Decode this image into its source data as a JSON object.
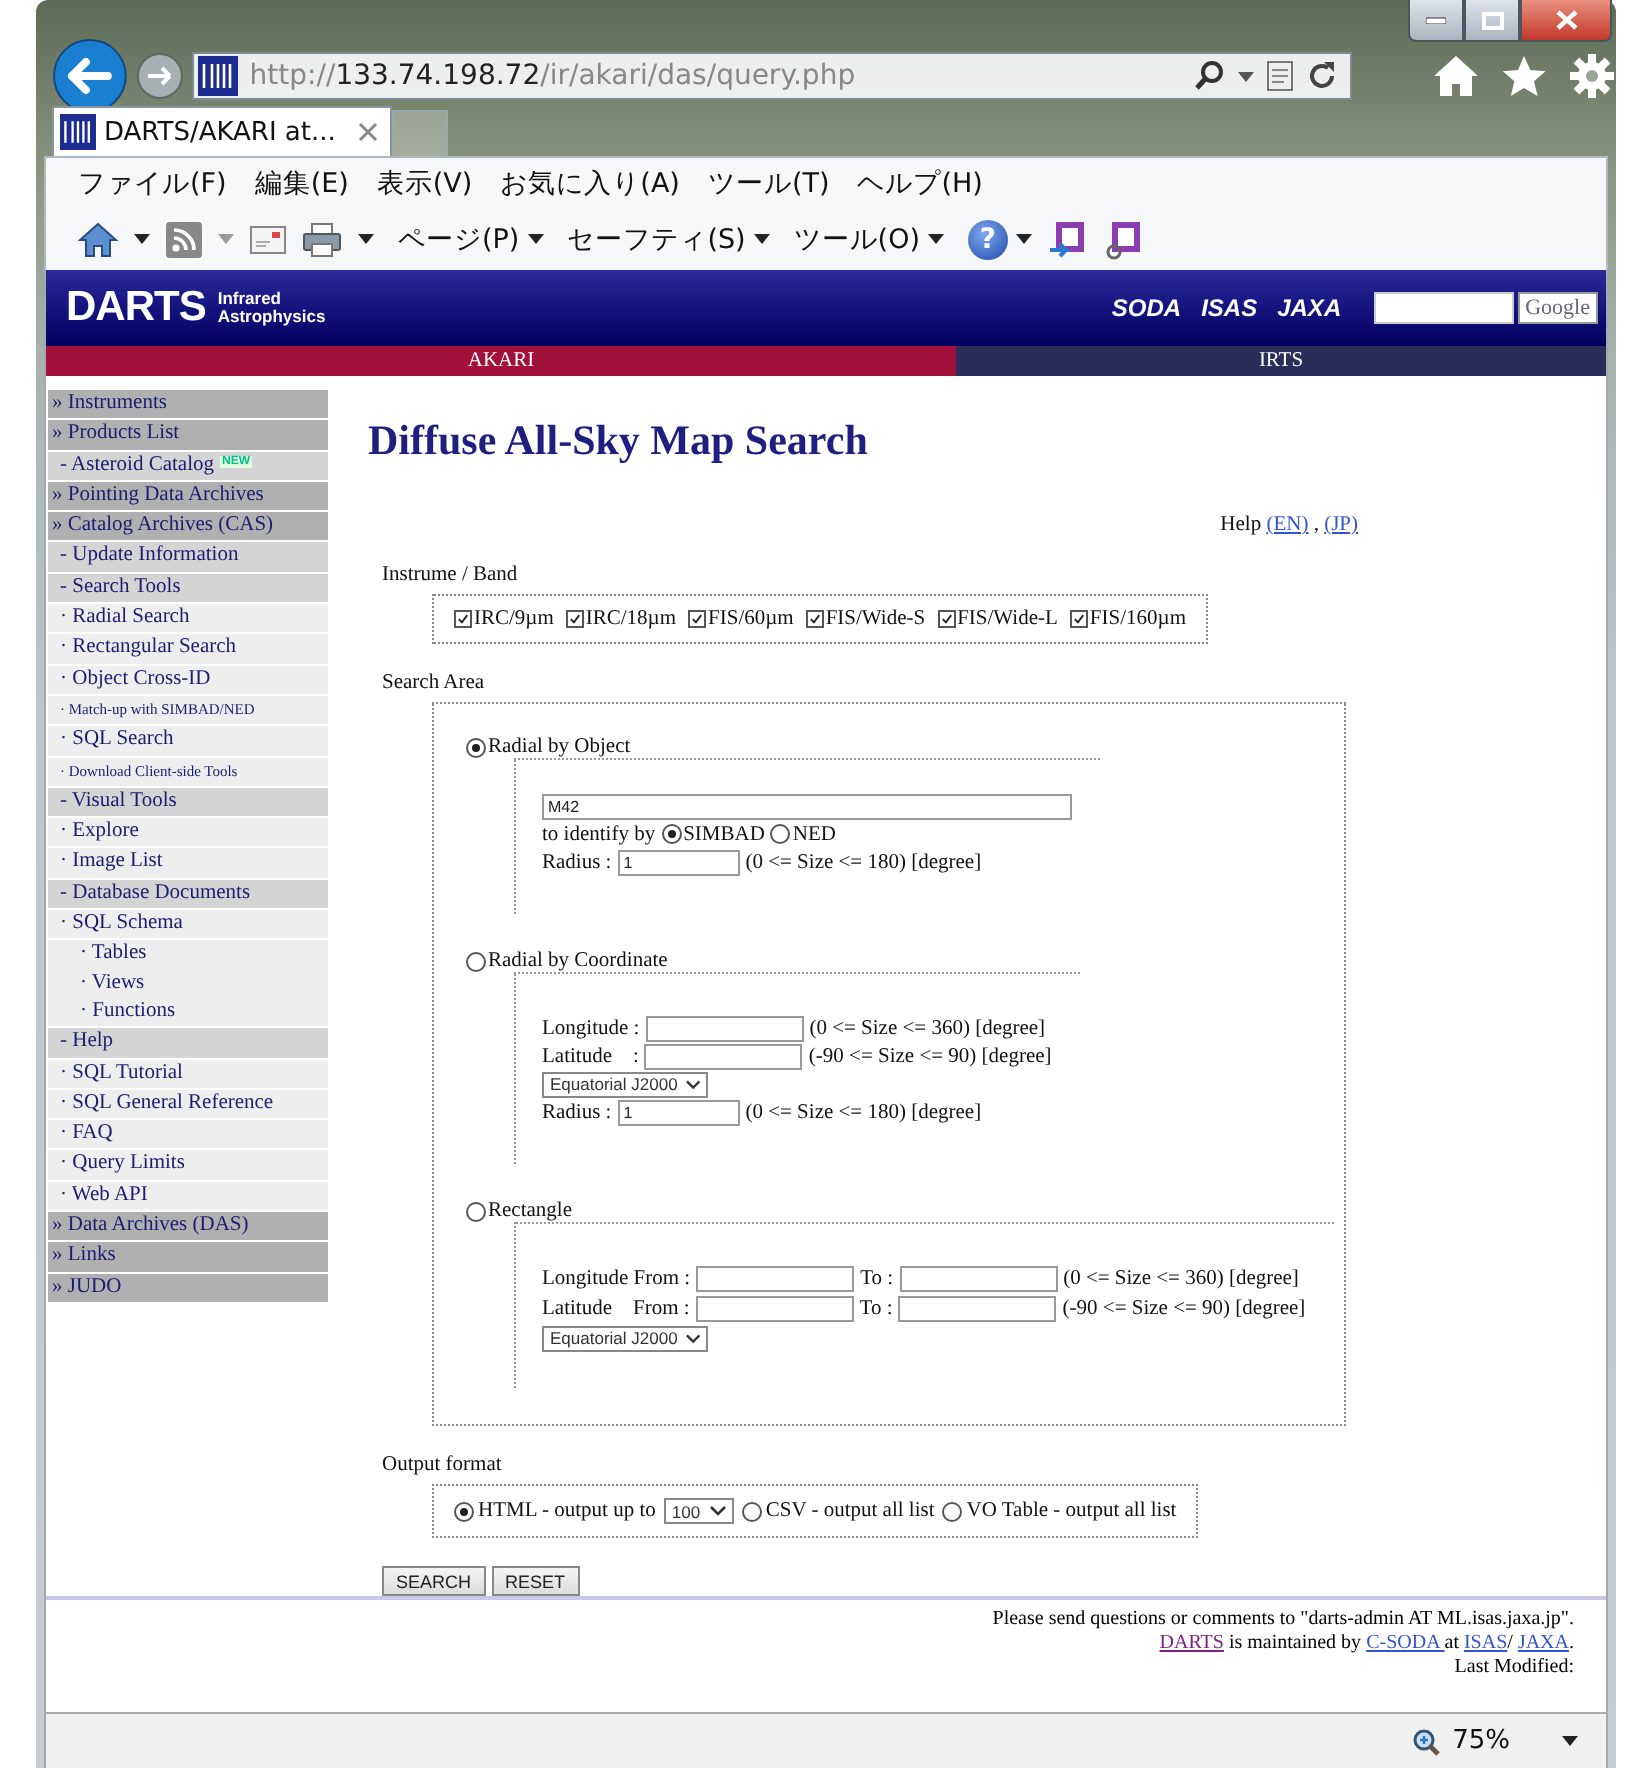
{
  "address": {
    "scheme": "http://",
    "host": "133.74.198.72",
    "path": "/ir/akari/das/query.php"
  },
  "tabs": [
    {
      "title": "DARTS/AKARI at...",
      "selected": true
    }
  ],
  "menu": [
    "ファイル(F)",
    "編集(E)",
    "表示(V)",
    "お気に入り(A)",
    "ツール(T)",
    "ヘルプ(H)"
  ],
  "toolbar_menus": [
    "ページ(P)",
    "セーフティ(S)",
    "ツール(O)"
  ],
  "help_symbol": "?",
  "site": {
    "logo": "DARTS",
    "subtitle": [
      "Infrared",
      "Astrophysics"
    ],
    "partner_logos": [
      "SODA",
      "ISAS",
      "JAXA"
    ],
    "search_button": "Google"
  },
  "nav": [
    {
      "label": "AKARI",
      "selected": true
    },
    {
      "label": "IRTS",
      "selected": false
    }
  ],
  "sidebar": [
    {
      "kind": "section",
      "label": "» Instruments"
    },
    {
      "kind": "section",
      "label": "» Products List"
    },
    {
      "kind": "group",
      "label": "- Asteroid Catalog",
      "badge": "NEW"
    },
    {
      "kind": "section",
      "label": "» Pointing Data Archives"
    },
    {
      "kind": "section",
      "label": "» Catalog Archives (CAS)"
    },
    {
      "kind": "group",
      "label": "- Update Information"
    },
    {
      "kind": "group",
      "label": "- Search Tools"
    },
    {
      "kind": "link",
      "label": "· Radial Search"
    },
    {
      "kind": "link",
      "label": "· Rectangular Search"
    },
    {
      "kind": "link",
      "label": "· Object Cross-ID"
    },
    {
      "kind": "small",
      "label": "· Match-up with SIMBAD/NED"
    },
    {
      "kind": "link",
      "label": "· SQL Search"
    },
    {
      "kind": "small",
      "label": "· Download Client-side Tools"
    },
    {
      "kind": "group",
      "label": "- Visual Tools"
    },
    {
      "kind": "link",
      "label": "· Explore"
    },
    {
      "kind": "link",
      "label": "· Image List"
    },
    {
      "kind": "group",
      "label": "- Database Documents"
    },
    {
      "kind": "link",
      "label": "· SQL Schema",
      "children": [
        {
          "kind": "link",
          "label": "· Tables"
        },
        {
          "kind": "link",
          "label": "· Views"
        },
        {
          "kind": "link",
          "label": "· Functions"
        }
      ]
    },
    {
      "kind": "group",
      "label": "- Help"
    },
    {
      "kind": "link",
      "label": "· SQL Tutorial"
    },
    {
      "kind": "link",
      "label": "· SQL General Reference"
    },
    {
      "kind": "link",
      "label": "· FAQ"
    },
    {
      "kind": "link",
      "label": "· Query Limits"
    },
    {
      "kind": "link",
      "label": "· Web API"
    },
    {
      "kind": "section",
      "label": "» Data Archives (DAS)"
    },
    {
      "kind": "section",
      "label": "» Links"
    },
    {
      "kind": "section",
      "label": "» JUDO"
    }
  ],
  "main": {
    "title": "Diffuse All-Sky Map Search",
    "help": {
      "label": "Help",
      "links": [
        "(EN)",
        "(JP)"
      ],
      "separator": ","
    },
    "bands": {
      "label": "Instrume / Band",
      "items": [
        {
          "label": "IRC/9µm",
          "checked": true
        },
        {
          "label": "IRC/18µm",
          "checked": true
        },
        {
          "label": "FIS/60µm",
          "checked": true
        },
        {
          "label": "FIS/Wide-S",
          "checked": true
        },
        {
          "label": "FIS/Wide-L",
          "checked": true
        },
        {
          "label": "FIS/160µm",
          "checked": true
        }
      ]
    },
    "search_area": {
      "label": "Search Area",
      "areas": [
        {
          "kind": "object",
          "label": "Radial by Object",
          "selected": true,
          "object_value": "M42",
          "identify_label": "to identify by",
          "identify_options": [
            {
              "label": "SIMBAD",
              "selected": true
            },
            {
              "label": "NED",
              "selected": false
            }
          ],
          "radius": {
            "label": "Radius :",
            "value": "1",
            "range": "(0 <= Size <= 180) [degree]"
          }
        },
        {
          "kind": "coordinate",
          "label": "Radial by Coordinate",
          "selected": false,
          "fields": [
            {
              "label": "Longitude :",
              "range": "(0 <= Size <= 360) [degree]"
            },
            {
              "label": "Latitude    :",
              "range": "(-90 <= Size <= 90) [degree]"
            }
          ],
          "frame": "Equatorial J2000",
          "radius": {
            "label": "Radius :",
            "value": "1",
            "range": "(0 <= Size <= 180) [degree]"
          }
        },
        {
          "kind": "rectangle",
          "label": "Rectangle",
          "selected": false,
          "rows": [
            {
              "label": "Longitude From :",
              "to_label": "To :",
              "range": "(0 <= Size <= 360) [degree]"
            },
            {
              "label": "Latitude    From :",
              "to_label": "To :",
              "range": "(-90 <= Size <= 90) [degree]"
            }
          ],
          "frame": "Equatorial J2000"
        }
      ]
    },
    "output": {
      "label": "Output format",
      "options": [
        {
          "label": "HTML - output up to",
          "selected": true,
          "limit": "100"
        },
        {
          "label": "CSV - output all list",
          "selected": false
        },
        {
          "label": "VO Table - output all list",
          "selected": false
        }
      ]
    },
    "buttons": [
      "SEARCH",
      "RESET"
    ]
  },
  "footer": {
    "contact": "Please send questions or comments to \"darts-admin AT ML.isas.jaxa.jp\".",
    "maintained": [
      {
        "text": "DARTS",
        "link": true,
        "visited": true
      },
      {
        "text": " is maintained by "
      },
      {
        "text": "C-SODA ",
        "link": true,
        "visited": false
      },
      {
        "text": " at "
      },
      {
        "text": "ISAS",
        "link": true,
        "visited": false
      },
      {
        "text": "/ "
      },
      {
        "text": "JAXA",
        "link": true,
        "visited": false
      },
      {
        "text": "."
      }
    ],
    "modified": "Last Modified:"
  },
  "status_bar": {
    "zoom": "75%"
  }
}
